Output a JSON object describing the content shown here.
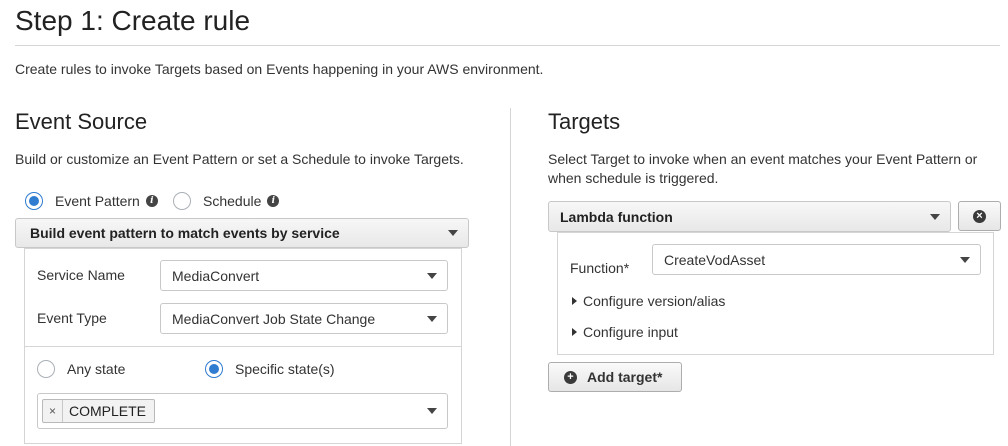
{
  "page": {
    "title": "Step 1: Create rule",
    "description": "Create rules to invoke Targets based on Events happening in your AWS environment."
  },
  "event_source": {
    "title": "Event Source",
    "description": "Build or customize an Event Pattern or set a Schedule to invoke Targets.",
    "mode_options": [
      {
        "label": "Event Pattern",
        "checked": true,
        "info_icon": "info-icon"
      },
      {
        "label": "Schedule",
        "checked": false,
        "info_icon": "info-icon"
      }
    ],
    "pattern_builder": {
      "selected": "Build event pattern to match events by service"
    },
    "service_name": {
      "label": "Service Name",
      "value": "MediaConvert"
    },
    "event_type": {
      "label": "Event Type",
      "value": "MediaConvert Job State Change"
    },
    "state_options": [
      {
        "label": "Any state",
        "checked": false
      },
      {
        "label": "Specific state(s)",
        "checked": true
      }
    ],
    "selected_states": [
      {
        "label": "COMPLETE",
        "remove_glyph": "×"
      }
    ]
  },
  "targets": {
    "title": "Targets",
    "description": "Select Target to invoke when an event matches your Event Pattern or when schedule is triggered.",
    "target_type": {
      "selected": "Lambda function"
    },
    "remove_icon": "close-circle-icon",
    "function": {
      "label": "Function*",
      "value": "CreateVodAsset"
    },
    "configure_version": "Configure version/alias",
    "configure_input": "Configure input",
    "add_target": {
      "label": "Add target*",
      "icon": "plus-circle-icon"
    }
  },
  "colors": {
    "accent": "#2f7cd0",
    "border": "#c8c8c8",
    "text": "#333333"
  }
}
